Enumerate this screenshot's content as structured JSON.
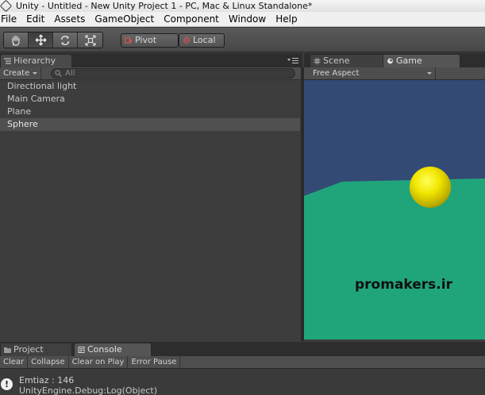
{
  "window": {
    "title": "Unity - Untitled - New Unity Project 1 - PC, Mac & Linux Standalone*"
  },
  "menu": [
    "File",
    "Edit",
    "Assets",
    "GameObject",
    "Component",
    "Window",
    "Help"
  ],
  "toolbar": {
    "tools": [
      "hand-icon",
      "move-icon",
      "rotate-icon",
      "scale-icon"
    ],
    "active_tool": "move-icon",
    "pivot_label": "Pivot",
    "local_label": "Local"
  },
  "hierarchy": {
    "tab_label": "Hierarchy",
    "create_label": "Create",
    "search_placeholder": "All",
    "items": [
      "Directional light",
      "Main Camera",
      "Plane",
      "Sphere"
    ],
    "selected": "Sphere"
  },
  "game": {
    "scene_tab": "Scene",
    "game_tab": "Game",
    "aspect_label": "Free Aspect",
    "watermark": "promakers.ir",
    "colors": {
      "sky": "#334a74",
      "ground": "#20a57b",
      "sphere": "#f2e600"
    }
  },
  "bottom": {
    "project_tab": "Project",
    "console_tab": "Console",
    "console_buttons": [
      "Clear",
      "Collapse",
      "Clear on Play",
      "Error Pause"
    ],
    "log": {
      "line1": "Emtiaz : 146",
      "line2": "UnityEngine.Debug:Log(Object)"
    }
  }
}
